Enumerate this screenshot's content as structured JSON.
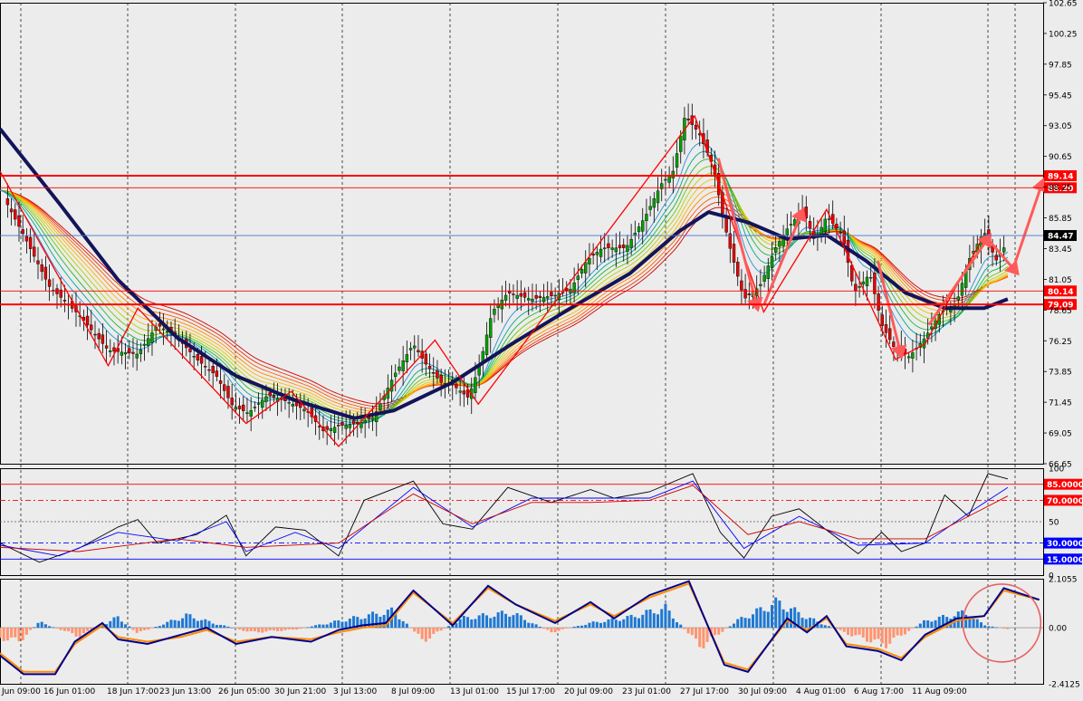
{
  "chart_data": [
    {
      "type": "candlestick",
      "panel": "price",
      "x_tick_labels": [
        "Jun 09:00",
        "16 Jun 01:00",
        "18 Jun 17:00",
        "23 Jun 13:00",
        "26 Jun 05:00",
        "30 Jun 21:00",
        "3 Jul 13:00",
        "8 Jul 09:00",
        "13 Jul 01:00",
        "15 Jul 17:00",
        "20 Jul 09:00",
        "23 Jul 01:00",
        "27 Jul 17:00",
        "30 Jul 09:00",
        "4 Aug 01:00",
        "6 Aug 17:00",
        "11 Aug 09:00"
      ],
      "y_tick_labels": [
        "102.65",
        "100.25",
        "97.85",
        "95.45",
        "93.05",
        "90.65",
        "88.25",
        "85.85",
        "83.45",
        "81.05",
        "78.65",
        "76.25",
        "73.85",
        "71.45",
        "69.05",
        "66.65"
      ],
      "ylim": [
        66.65,
        102.65
      ],
      "grid": true,
      "close_path": [
        [
          0,
          88.0
        ],
        [
          12,
          84.5
        ],
        [
          25,
          80.5
        ],
        [
          40,
          78.3
        ],
        [
          55,
          75.5
        ],
        [
          70,
          75.2
        ],
        [
          80,
          77.5
        ],
        [
          90,
          76.5
        ],
        [
          100,
          74.8
        ],
        [
          110,
          73.5
        ],
        [
          118,
          71.2
        ],
        [
          126,
          70.6
        ],
        [
          136,
          72.0
        ],
        [
          146,
          71.5
        ],
        [
          156,
          70.8
        ],
        [
          164,
          69.2
        ],
        [
          172,
          69.6
        ],
        [
          182,
          69.8
        ],
        [
          190,
          70.3
        ],
        [
          200,
          73.5
        ],
        [
          210,
          76.0
        ],
        [
          216,
          74.5
        ],
        [
          224,
          73.0
        ],
        [
          230,
          72.8
        ],
        [
          238,
          71.8
        ],
        [
          244,
          74.5
        ],
        [
          250,
          78.5
        ],
        [
          258,
          80.0
        ],
        [
          270,
          79.5
        ],
        [
          282,
          79.8
        ],
        [
          290,
          80.3
        ],
        [
          298,
          82.5
        ],
        [
          306,
          83.5
        ],
        [
          318,
          83.5
        ],
        [
          328,
          86.0
        ],
        [
          336,
          88.5
        ],
        [
          342,
          89.5
        ],
        [
          348,
          93.8
        ],
        [
          355,
          92.5
        ],
        [
          362,
          90.0
        ],
        [
          370,
          84.0
        ],
        [
          378,
          79.5
        ],
        [
          386,
          80.5
        ],
        [
          394,
          83.5
        ],
        [
          400,
          85.0
        ],
        [
          408,
          86.5
        ],
        [
          414,
          84.0
        ],
        [
          420,
          86.0
        ],
        [
          428,
          84.5
        ],
        [
          434,
          80.0
        ],
        [
          442,
          81.5
        ],
        [
          448,
          77.5
        ],
        [
          454,
          75.8
        ],
        [
          462,
          75.0
        ],
        [
          470,
          76.5
        ],
        [
          478,
          78.5
        ],
        [
          486,
          79.2
        ],
        [
          492,
          82.5
        ],
        [
          500,
          84.8
        ],
        [
          506,
          82.5
        ],
        [
          512,
          84.0
        ]
      ],
      "ema_thick_path": [
        [
          0,
          92.8
        ],
        [
          30,
          87.0
        ],
        [
          60,
          81.0
        ],
        [
          90,
          76.5
        ],
        [
          120,
          73.5
        ],
        [
          150,
          71.6
        ],
        [
          180,
          70.2
        ],
        [
          200,
          70.8
        ],
        [
          230,
          73.0
        ],
        [
          260,
          76.0
        ],
        [
          290,
          78.8
        ],
        [
          320,
          81.5
        ],
        [
          345,
          84.8
        ],
        [
          360,
          86.3
        ],
        [
          380,
          85.5
        ],
        [
          400,
          84.2
        ],
        [
          420,
          84.5
        ],
        [
          440,
          82.5
        ],
        [
          460,
          80.0
        ],
        [
          480,
          78.8
        ],
        [
          500,
          78.8
        ],
        [
          512,
          79.5
        ]
      ],
      "zigzag": [
        [
          0,
          89.5
        ],
        [
          55,
          74.3
        ],
        [
          70,
          78.8
        ],
        [
          125,
          69.8
        ],
        [
          148,
          72.3
        ],
        [
          172,
          68.0
        ],
        [
          221,
          76.3
        ],
        [
          243,
          71.3
        ],
        [
          353,
          93.8
        ],
        [
          388,
          78.5
        ],
        [
          420,
          86.5
        ],
        [
          455,
          74.8
        ],
        [
          470,
          76.0
        ],
        [
          500,
          84.5
        ]
      ],
      "arrows": [
        [
          [
            365,
            90.5
          ],
          [
            385,
            78.7
          ]
        ],
        [
          [
            388,
            79.0
          ],
          [
            408,
            86.5
          ]
        ],
        [
          [
            446,
            82.5
          ],
          [
            458,
            75.0
          ]
        ],
        [
          [
            472,
            77.5
          ],
          [
            503,
            84.5
          ]
        ],
        [
          [
            503,
            84.0
          ],
          [
            517,
            81.5
          ]
        ],
        [
          [
            515,
            82.0
          ],
          [
            530,
            88.8
          ]
        ]
      ],
      "levels": [
        {
          "value": 89.14,
          "label": "89.14",
          "color": "#ff0000"
        },
        {
          "value": 88.2,
          "label": "88.20",
          "color": "#ff0000"
        },
        {
          "value": 80.14,
          "label": "80.14",
          "color": "#ff0000"
        },
        {
          "value": 79.09,
          "label": "79.09",
          "color": "#ff0000"
        },
        {
          "value": 84.47,
          "label": "84.47",
          "color": "#000000"
        }
      ]
    },
    {
      "type": "line",
      "panel": "oscillator",
      "ylim": [
        0,
        100
      ],
      "y_tick_labels": [
        "100",
        "85.0000",
        "70.0000",
        "50",
        "30.0000",
        "15.0000",
        "0"
      ],
      "levels": [
        {
          "value": 85,
          "label": "85.0000",
          "color": "#ff0000"
        },
        {
          "value": 70,
          "label": "70.0000",
          "color": "#ff0000"
        },
        {
          "value": 30,
          "label": "30.0000",
          "color": "#0000ff"
        },
        {
          "value": 15,
          "label": "15.0000",
          "color": "#0000ff"
        }
      ],
      "series": [
        {
          "color": "#000000",
          "values": [
            [
              0,
              30
            ],
            [
              20,
              12
            ],
            [
              40,
              25
            ],
            [
              60,
              45
            ],
            [
              70,
              52
            ],
            [
              80,
              30
            ],
            [
              100,
              38
            ],
            [
              115,
              56
            ],
            [
              125,
              18
            ],
            [
              140,
              45
            ],
            [
              155,
              42
            ],
            [
              172,
              18
            ],
            [
              185,
              70
            ],
            [
              210,
              88
            ],
            [
              225,
              48
            ],
            [
              240,
              43
            ],
            [
              258,
              82
            ],
            [
              280,
              68
            ],
            [
              300,
              80
            ],
            [
              312,
              72
            ],
            [
              330,
              78
            ],
            [
              352,
              95
            ],
            [
              366,
              40
            ],
            [
              378,
              16
            ],
            [
              392,
              55
            ],
            [
              406,
              62
            ],
            [
              420,
              42
            ],
            [
              436,
              20
            ],
            [
              448,
              40
            ],
            [
              458,
              22
            ],
            [
              470,
              30
            ],
            [
              480,
              75
            ],
            [
              492,
              55
            ],
            [
              502,
              95
            ],
            [
              512,
              90
            ]
          ]
        },
        {
          "color": "#0000ff",
          "values": [
            [
              0,
              28
            ],
            [
              30,
              18
            ],
            [
              60,
              40
            ],
            [
              90,
              32
            ],
            [
              115,
              50
            ],
            [
              125,
              22
            ],
            [
              150,
              40
            ],
            [
              172,
              25
            ],
            [
              210,
              82
            ],
            [
              240,
              45
            ],
            [
              270,
              72
            ],
            [
              300,
              72
            ],
            [
              330,
              72
            ],
            [
              352,
              88
            ],
            [
              378,
              25
            ],
            [
              406,
              55
            ],
            [
              436,
              28
            ],
            [
              470,
              30
            ],
            [
              492,
              58
            ],
            [
              512,
              82
            ]
          ]
        },
        {
          "color": "#cc0000",
          "values": [
            [
              0,
              26
            ],
            [
              40,
              22
            ],
            [
              90,
              34
            ],
            [
              125,
              26
            ],
            [
              172,
              30
            ],
            [
              210,
              76
            ],
            [
              240,
              48
            ],
            [
              270,
              68
            ],
            [
              300,
              68
            ],
            [
              330,
              70
            ],
            [
              352,
              84
            ],
            [
              380,
              38
            ],
            [
              406,
              50
            ],
            [
              436,
              34
            ],
            [
              470,
              34
            ],
            [
              492,
              55
            ],
            [
              512,
              74
            ]
          ]
        }
      ]
    },
    {
      "type": "bar",
      "panel": "macd",
      "ylim": [
        -2.4125,
        2.1055
      ],
      "y_tick_labels": [
        "2.1055",
        "0.00",
        "-2.4125"
      ],
      "histogram": [
        [
          0,
          -0.55
        ],
        [
          10,
          -0.7
        ],
        [
          20,
          0.3
        ],
        [
          40,
          -0.45
        ],
        [
          60,
          0.55
        ],
        [
          70,
          -0.3
        ],
        [
          95,
          0.65
        ],
        [
          110,
          0.2
        ],
        [
          128,
          -0.25
        ],
        [
          150,
          -0.1
        ],
        [
          172,
          0.35
        ],
        [
          200,
          0.9
        ],
        [
          215,
          -0.7
        ],
        [
          235,
          0.5
        ],
        [
          260,
          0.8
        ],
        [
          280,
          -0.25
        ],
        [
          300,
          0.25
        ],
        [
          320,
          0.55
        ],
        [
          338,
          1.05
        ],
        [
          356,
          -1.0
        ],
        [
          375,
          0.4
        ],
        [
          395,
          1.35
        ],
        [
          410,
          0.55
        ],
        [
          430,
          -0.3
        ],
        [
          450,
          -0.9
        ],
        [
          470,
          0.35
        ],
        [
          490,
          0.8
        ],
        [
          500,
          0.15
        ],
        [
          512,
          -0.1
        ]
      ],
      "series": [
        {
          "color": "#ff8c00",
          "values": [
            [
              0,
              -1.1
            ],
            [
              12,
              -1.9
            ],
            [
              28,
              -1.9
            ],
            [
              38,
              -0.7
            ],
            [
              52,
              0.1
            ],
            [
              60,
              -0.4
            ],
            [
              75,
              -0.6
            ],
            [
              92,
              -0.4
            ],
            [
              105,
              -0.1
            ],
            [
              120,
              -0.6
            ],
            [
              138,
              -0.4
            ],
            [
              158,
              -0.5
            ],
            [
              172,
              -0.2
            ],
            [
              184,
              0.0
            ],
            [
              196,
              0.1
            ],
            [
              210,
              1.5
            ],
            [
              230,
              0.2
            ],
            [
              248,
              1.7
            ],
            [
              262,
              1.0
            ],
            [
              282,
              0.3
            ],
            [
              300,
              1.0
            ],
            [
              312,
              0.5
            ],
            [
              330,
              1.3
            ],
            [
              350,
              1.9
            ],
            [
              368,
              -1.5
            ],
            [
              380,
              -1.8
            ],
            [
              400,
              0.3
            ],
            [
              410,
              -0.1
            ],
            [
              420,
              0.4
            ],
            [
              430,
              -0.7
            ],
            [
              446,
              -0.9
            ],
            [
              458,
              -1.3
            ],
            [
              470,
              -0.4
            ],
            [
              486,
              0.3
            ],
            [
              500,
              0.5
            ],
            [
              510,
              1.6
            ],
            [
              528,
              1.2
            ]
          ]
        },
        {
          "color": "#00008b",
          "values": [
            [
              0,
              -1.2
            ],
            [
              12,
              -2.0
            ],
            [
              28,
              -2.0
            ],
            [
              38,
              -0.6
            ],
            [
              52,
              0.2
            ],
            [
              60,
              -0.5
            ],
            [
              75,
              -0.7
            ],
            [
              92,
              -0.3
            ],
            [
              105,
              0.0
            ],
            [
              120,
              -0.7
            ],
            [
              138,
              -0.4
            ],
            [
              158,
              -0.6
            ],
            [
              172,
              -0.1
            ],
            [
              184,
              0.1
            ],
            [
              196,
              0.2
            ],
            [
              210,
              1.6
            ],
            [
              230,
              0.1
            ],
            [
              248,
              1.8
            ],
            [
              262,
              1.0
            ],
            [
              282,
              0.2
            ],
            [
              300,
              1.1
            ],
            [
              312,
              0.4
            ],
            [
              330,
              1.4
            ],
            [
              350,
              2.0
            ],
            [
              368,
              -1.6
            ],
            [
              380,
              -1.9
            ],
            [
              400,
              0.4
            ],
            [
              410,
              -0.2
            ],
            [
              420,
              0.5
            ],
            [
              430,
              -0.8
            ],
            [
              446,
              -1.0
            ],
            [
              458,
              -1.4
            ],
            [
              470,
              -0.3
            ],
            [
              486,
              0.4
            ],
            [
              500,
              0.5
            ],
            [
              510,
              1.7
            ],
            [
              528,
              1.2
            ]
          ]
        }
      ]
    }
  ]
}
